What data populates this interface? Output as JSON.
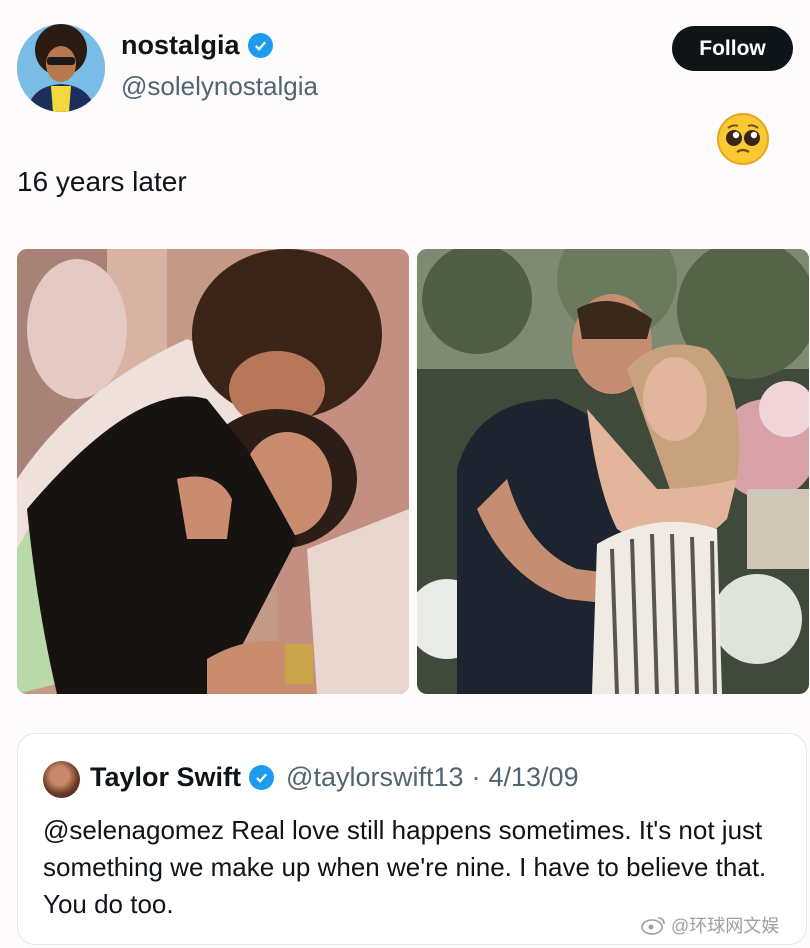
{
  "header": {
    "display_name": "nostalgia",
    "handle": "@solelynostalgia",
    "follow_label": "Follow",
    "verified_icon": "verified-badge-icon"
  },
  "tweet": {
    "text": "16 years later",
    "emoji": "pleading-face-emoji"
  },
  "media": [
    {
      "name": "couple-photo-left",
      "description_icon": "photo-image"
    },
    {
      "name": "couple-photo-right",
      "description_icon": "photo-image"
    }
  ],
  "quote": {
    "display_name": "Taylor Swift",
    "handle": "@taylorswift13",
    "separator": "·",
    "date": "4/13/09",
    "text": "@selenagomez Real love still happens sometimes. It's not just something we make up when we're nine. I have to believe that. You do too."
  },
  "watermark": {
    "text": "@环球网文娱"
  },
  "colors": {
    "verified": "#1d9bf0",
    "follow_bg": "#0f1419",
    "secondary_text": "#536471"
  }
}
